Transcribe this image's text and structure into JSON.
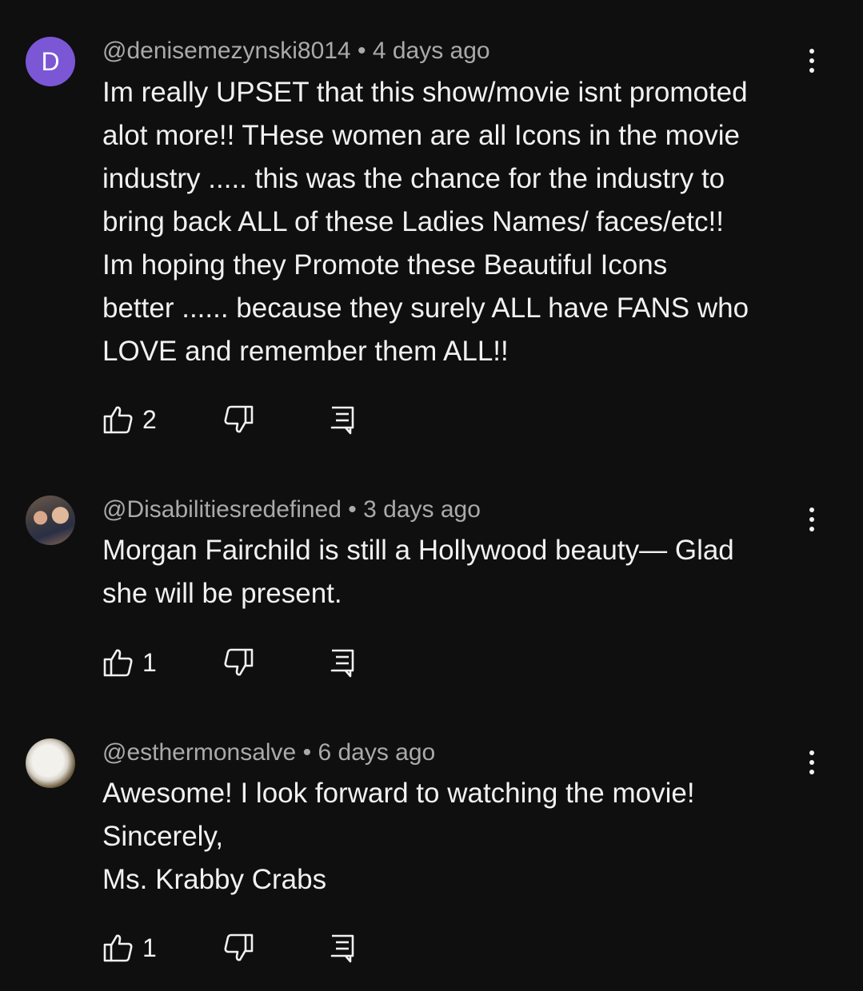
{
  "comments": [
    {
      "avatar_letter": "D",
      "avatar_color": "#7b57d6",
      "handle": "@denisemezynski8014",
      "separator": "•",
      "time": "4 days ago",
      "text": "Im really UPSET that this show/movie isnt promoted\nalot more!!  THese women are all Icons in the movie\nindustry ..... this was the chance for the industry to\nbring back ALL of these Ladies Names/ faces/etc!!\nIm hoping they Promote these Beautiful Icons\nbetter ...... because they surely ALL have FANS who\nLOVE and remember them ALL!!",
      "likes": "2"
    },
    {
      "handle": "@Disabilitiesredefined",
      "separator": "•",
      "time": "3 days ago",
      "text": "Morgan Fairchild is still a Hollywood beauty— Glad\nshe will be present.",
      "likes": "1"
    },
    {
      "handle": "@esthermonsalve",
      "separator": "•",
      "time": "6 days ago",
      "text": "Awesome!  I look forward to watching the movie!\nSincerely,\nMs. Krabby Crabs",
      "likes": "1"
    }
  ],
  "icons": {
    "like": "thumbs-up-icon",
    "dislike": "thumbs-down-icon",
    "reply": "reply-icon",
    "menu": "more-vert-icon"
  },
  "colors": {
    "background": "#0f0f0f",
    "text": "#f1f1f1",
    "meta": "#aaaaaa"
  }
}
